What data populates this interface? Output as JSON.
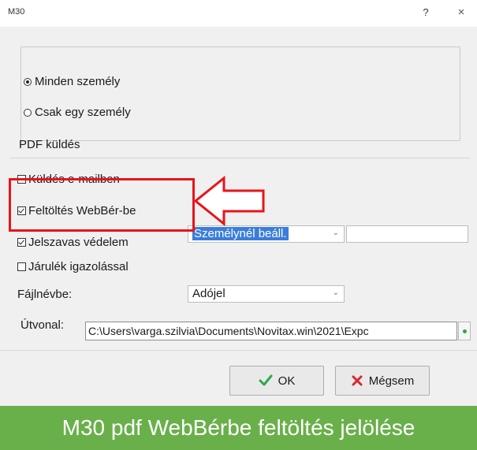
{
  "window": {
    "title": "M30",
    "help_label": "?",
    "close_label": "×"
  },
  "person_group": {
    "options": [
      {
        "label": "Minden személy",
        "selected": true
      },
      {
        "label": "Csak egy személy",
        "selected": false
      }
    ]
  },
  "pdf_section": {
    "heading": "PDF küldés",
    "send_email": {
      "label": "Küldés e-mailben",
      "checked": false
    },
    "upload_webber": {
      "label": "Feltöltés WebBér-be",
      "checked": true
    },
    "password_protect": {
      "label": "Jelszavas védelem",
      "checked": true
    },
    "password_combo": {
      "value": "Személynél beáll.",
      "arrow": "⌄"
    },
    "contribution_cert": {
      "label": "Járulék igazolással",
      "checked": false
    },
    "filename_label": "Fájlnévbe:",
    "filename_combo": {
      "value": "Adójel",
      "arrow": "⌄"
    },
    "path_label": "Útvonal:",
    "path_value": "C:\\Users\\varga.szilvia\\Documents\\Novitax.win\\2021\\Expc"
  },
  "buttons": {
    "ok_label": "OK",
    "cancel_label": "Mégsem"
  },
  "caption": "M30 pdf WebBérbe feltöltés jelölése",
  "colors": {
    "highlight": "#e8141c",
    "caption_bg": "#69b04a",
    "ok_icon": "#2ea84a",
    "cancel_icon": "#d9262b",
    "selection": "#3b7ddb"
  }
}
